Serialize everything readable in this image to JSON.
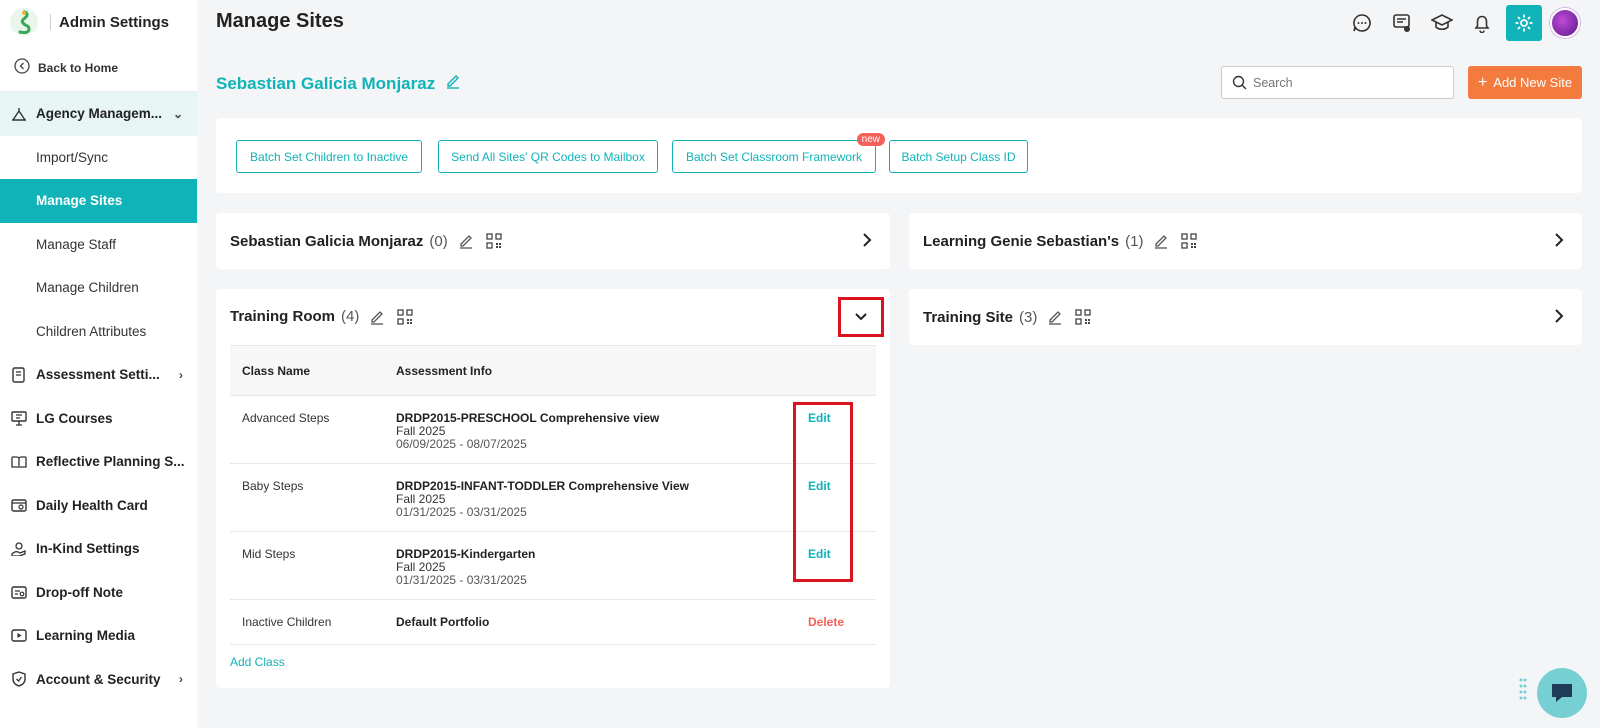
{
  "app": {
    "title": "Admin Settings",
    "back_label": "Back to Home"
  },
  "sidebar": {
    "items": [
      {
        "label": "Agency Managem...",
        "icon": "agency-icon",
        "expanded": true,
        "children": [
          {
            "label": "Import/Sync"
          },
          {
            "label": "Manage Sites",
            "active": true
          },
          {
            "label": "Manage Staff"
          },
          {
            "label": "Manage Children"
          },
          {
            "label": "Children Attributes"
          }
        ]
      },
      {
        "label": "Assessment Setti...",
        "icon": "assessment-icon",
        "has_chevron": true
      },
      {
        "label": "LG Courses",
        "icon": "courses-icon"
      },
      {
        "label": "Reflective Planning S...",
        "icon": "book-icon"
      },
      {
        "label": "Daily Health Card",
        "icon": "health-card-icon"
      },
      {
        "label": "In-Kind Settings",
        "icon": "hand-icon"
      },
      {
        "label": "Drop-off Note",
        "icon": "note-icon"
      },
      {
        "label": "Learning Media",
        "icon": "media-icon"
      },
      {
        "label": "Account & Security",
        "icon": "shield-icon",
        "has_chevron": true
      }
    ]
  },
  "header": {
    "page_title": "Manage Sites"
  },
  "agency": {
    "name": "Sebastian Galicia Monjaraz"
  },
  "search": {
    "placeholder": "Search"
  },
  "add_site_label": "Add New Site",
  "batch_buttons": [
    {
      "label": "Batch Set Children to Inactive"
    },
    {
      "label": "Send All Sites' QR Codes to Mailbox"
    },
    {
      "label": "Batch Set Classroom Framework",
      "badge": "new"
    },
    {
      "label": "Batch Setup Class ID"
    }
  ],
  "sites": [
    {
      "name": "Sebastian Galicia Monjaraz",
      "count": "(0)"
    },
    {
      "name": "Learning Genie Sebastian's",
      "count": "(1)"
    },
    {
      "name": "Training Room",
      "count": "(4)"
    },
    {
      "name": "Training Site",
      "count": "(3)"
    }
  ],
  "class_table": {
    "headers": [
      "Class Name",
      "Assessment Info"
    ],
    "rows": [
      {
        "name": "Advanced Steps",
        "framework": "DRDP2015-PRESCHOOL Comprehensive view",
        "term": "Fall 2025",
        "dates": "06/09/2025 - 08/07/2025",
        "action": "Edit"
      },
      {
        "name": "Baby Steps",
        "framework": "DRDP2015-INFANT-TODDLER Comprehensive View",
        "term": "Fall 2025",
        "dates": "01/31/2025 - 03/31/2025",
        "action": "Edit"
      },
      {
        "name": "Mid Steps",
        "framework": "DRDP2015-Kindergarten",
        "term": "Fall 2025",
        "dates": "01/31/2025 - 03/31/2025",
        "action": "Edit"
      },
      {
        "name": "Inactive Children",
        "framework": "Default Portfolio",
        "action": "Delete"
      }
    ],
    "add_class_label": "Add Class"
  },
  "colors": {
    "accent": "#10b3b8",
    "orange": "#f47b3e",
    "danger": "#f4605a",
    "highlight": "#d9141e"
  }
}
